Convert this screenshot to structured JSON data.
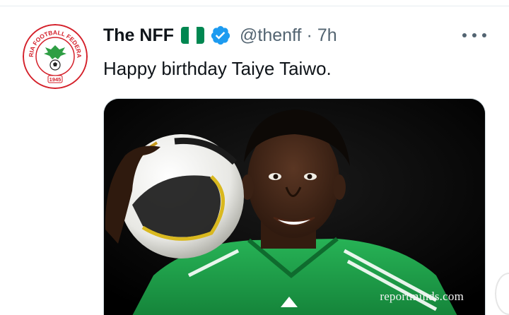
{
  "tweet": {
    "author_name": "The NFF",
    "handle": "@thenff",
    "separator": "·",
    "time": "7h",
    "text": "Happy birthday Taiye Taiwo.",
    "flag_icon": "nigeria-flag-icon",
    "verified_icon": "verified-badge-icon",
    "more_icon": "more-options-icon"
  },
  "avatar": {
    "logo_top_text": "NIGERIA FOOTBALL FEDERATION",
    "logo_year": "1945"
  },
  "media": {
    "watermark": "reportminds.com"
  },
  "colors": {
    "accent_blue": "#1d9bf0",
    "flag_green": "#008751",
    "logo_red": "#d4202a",
    "shirt_green": "#1fa24a"
  }
}
